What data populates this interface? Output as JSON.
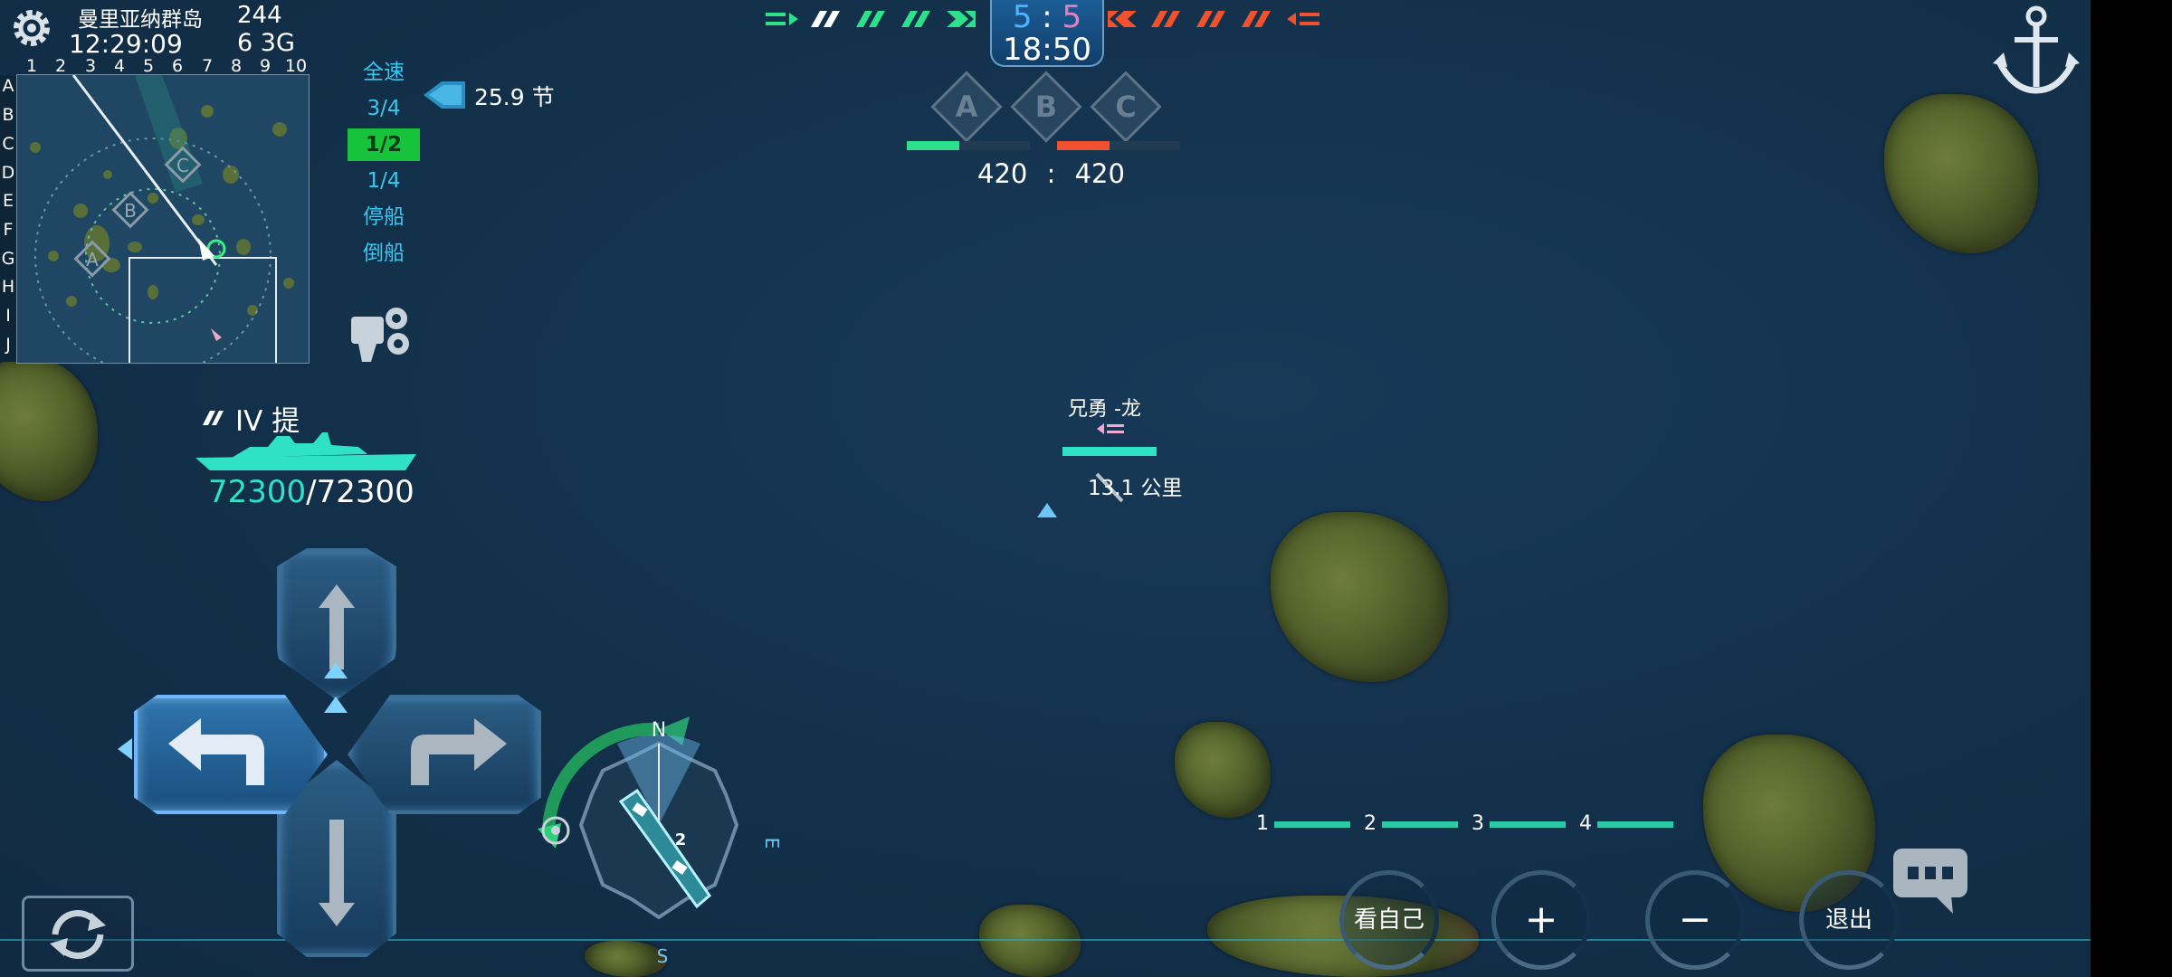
{
  "map": {
    "name": "曼里亚纳群岛",
    "ping": "244",
    "clock": "12:29:09",
    "signal": "6  3G"
  },
  "minimap": {
    "columns": [
      "1",
      "2",
      "3",
      "4",
      "5",
      "6",
      "7",
      "8",
      "9",
      "10"
    ],
    "rows": [
      "A",
      "B",
      "C",
      "D",
      "E",
      "F",
      "G",
      "H",
      "I",
      "J"
    ],
    "points": [
      "A",
      "B",
      "C"
    ]
  },
  "speed": {
    "options": [
      "全速",
      "3/4",
      "1/2",
      "1/4",
      "停船",
      "倒船"
    ],
    "selected": "1/2",
    "current": "25.9 节"
  },
  "player_ship": {
    "name": "IV 提",
    "hp_current": "72300",
    "hp_max": "/72300"
  },
  "score": {
    "ally": "5",
    "separator": ":",
    "enemy": "5",
    "timer": "18:50"
  },
  "capture_points": [
    "A",
    "B",
    "C"
  ],
  "team_points": {
    "ally": "420",
    "separator": ":",
    "enemy": "420"
  },
  "target": {
    "name": "兄勇 -龙",
    "distance": "13.1 公里"
  },
  "compass": {
    "n": "N",
    "e": "E",
    "s": "S",
    "ship_count": "2"
  },
  "weapon_slots": [
    "1",
    "2",
    "3",
    "4"
  ],
  "buttons": {
    "view_self": "看自己",
    "zoom_in": "+",
    "zoom_out": "−",
    "exit": "退出"
  },
  "colors": {
    "ally": "#2fe08a",
    "enemy": "#f0512e",
    "accent": "#37c8f0",
    "selected_speed": "#17c33a"
  }
}
